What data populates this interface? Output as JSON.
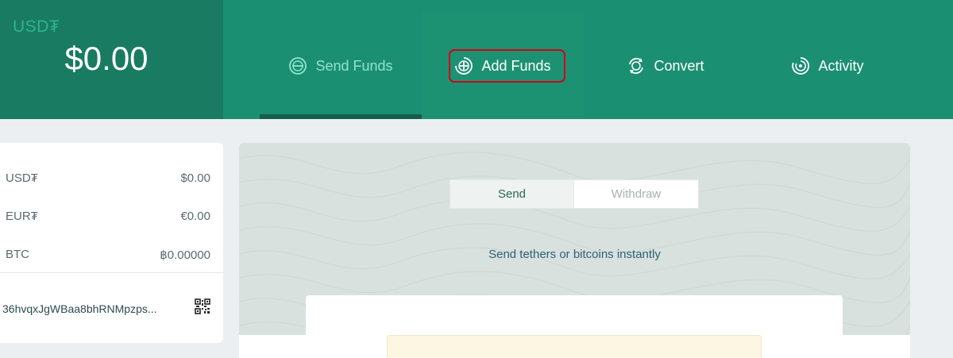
{
  "balance": {
    "currency": "USD₮",
    "amount": "$0.00"
  },
  "nav": {
    "tabs": [
      {
        "label": "Send Funds",
        "icon": "send-funds-icon"
      },
      {
        "label": "Add Funds",
        "icon": "add-funds-icon"
      },
      {
        "label": "Convert",
        "icon": "convert-icon"
      },
      {
        "label": "Activity",
        "icon": "activity-icon"
      }
    ],
    "active": "Send Funds",
    "highlighted": "Add Funds"
  },
  "wallet": {
    "rows": [
      {
        "name": "USD₮",
        "value": "$0.00"
      },
      {
        "name": "EUR₮",
        "value": "€0.00"
      },
      {
        "name": "BTC",
        "value": "฿0.00000"
      }
    ],
    "address": "36hvqxJgWBaa8bhRNMpzps...",
    "qr_icon": "qr-code-icon"
  },
  "main": {
    "toggle": {
      "send": "Send",
      "withdraw": "Withdraw",
      "selected": "Send"
    },
    "subtitle": "Send tethers or bitcoins instantly"
  },
  "colors": {
    "header": "#1b8f72",
    "balance_panel": "#187b62",
    "highlight_border": "#d0021b",
    "active_tab_text": "#8fe4cb"
  }
}
